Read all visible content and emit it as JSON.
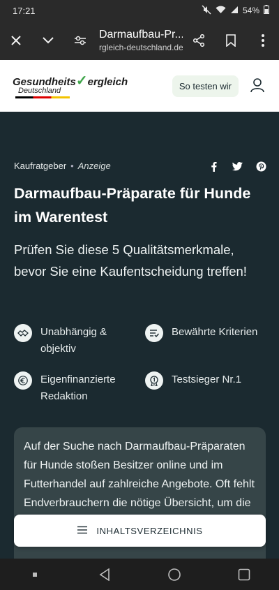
{
  "status": {
    "time": "17:21",
    "battery": "54%"
  },
  "browser": {
    "title": "Darmaufbau-Pr...",
    "url": "rgleich-deutschland.de"
  },
  "site": {
    "logo_main_a": "Gesundheits",
    "logo_main_b": "ergleich",
    "logo_sub": "Deutschland",
    "test_button": "So testen wir"
  },
  "article": {
    "category": "Kaufratgeber",
    "separator": "•",
    "ad_label": "Anzeige",
    "headline": "Darmaufbau-Präparate für Hunde im Warentest",
    "subline": "Prüfen Sie diese 5 Qualitätsmerkmale, bevor Sie eine Kaufentscheidung treffen!",
    "features": [
      {
        "label": "Unabhängig & objektiv",
        "icon": "handshake-icon"
      },
      {
        "label": "Bewährte Kriterien",
        "icon": "checklist-icon"
      },
      {
        "label": "Eigenfinanzierte Redaktion",
        "icon": "euro-icon"
      },
      {
        "label": "Testsieger Nr.1",
        "icon": "award-icon"
      }
    ],
    "intro": "Auf der Suche nach Darmaufbau-Präparaten für Hunde stoßen Besitzer online und im Futterhandel auf zahlreiche Angebote. Oft fehlt Endverbrauchern die nötige Übersicht, um die Qualität der Produkte zu bewerten."
  },
  "toc": {
    "label": "INHALTSVERZEICHNIS"
  },
  "colors": {
    "page_bg": "#1b2a30",
    "card_bg": "#364548",
    "accent_green": "#3fa54a"
  }
}
